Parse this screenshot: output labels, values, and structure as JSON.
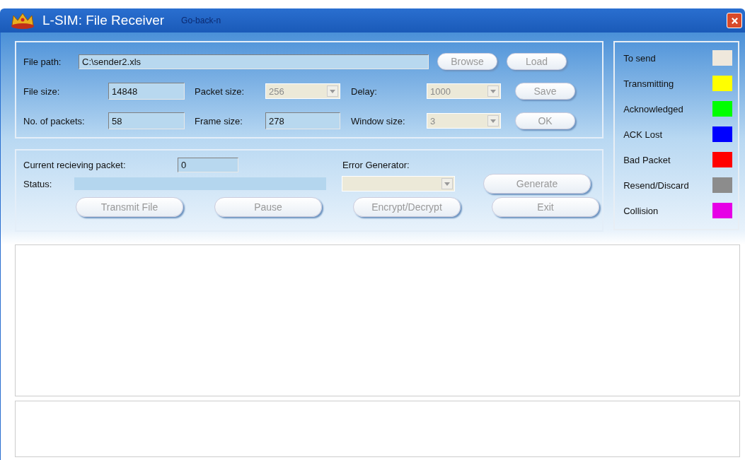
{
  "window": {
    "title": "L-SIM: File Receiver",
    "subtitle": "Go-back-n"
  },
  "file_panel": {
    "path": {
      "label": "File path:",
      "value": "C:\\sender2.xls"
    },
    "buttons": [
      {
        "label": "Browse",
        "disabled": true
      },
      {
        "label": "Load",
        "disabled": true
      }
    ],
    "rows": [
      {
        "label": "File size:",
        "value": "14848",
        "combo_label": "Packet size:",
        "combo_value": "256",
        "combo_disabled": true,
        "combo2_label": "Delay:",
        "combo2_value": "1000",
        "combo2_disabled": true,
        "button": {
          "label": "Save",
          "disabled": true
        }
      },
      {
        "label": "No. of packets:",
        "value": "58",
        "combo_label": "Frame size:",
        "combo_value": "278",
        "combo_disabled": false,
        "combo2_label": "Window size:",
        "combo2_value": "3",
        "combo2_disabled": true,
        "button": {
          "label": "OK",
          "disabled": true
        }
      }
    ]
  },
  "transfer_panel": {
    "current_label": "Current recieving packet:",
    "current_value": "0",
    "status_label": "Status:",
    "error_label": "Error Generator:",
    "error_disabled": true,
    "generate": {
      "label": "Generate",
      "disabled": true
    },
    "buttons": [
      {
        "label": "Transmit File",
        "disabled": true
      },
      {
        "label": "Pause",
        "disabled": true
      },
      {
        "label": "Encrypt/Decrypt",
        "disabled": true
      },
      {
        "label": "Exit",
        "disabled": true
      }
    ]
  },
  "legend": [
    {
      "label": "To send",
      "color": "#efe8dc"
    },
    {
      "label": "Transmitting",
      "color": "#ffff00"
    },
    {
      "label": "Acknowledged",
      "color": "#00ff00"
    },
    {
      "label": "ACK Lost",
      "color": "#0000ff"
    },
    {
      "label": "Bad Packet",
      "color": "#ff0000"
    },
    {
      "label": "Resend/Discard",
      "color": "#8c8c8c"
    },
    {
      "label": "Collision",
      "color": "#e600e6"
    }
  ]
}
